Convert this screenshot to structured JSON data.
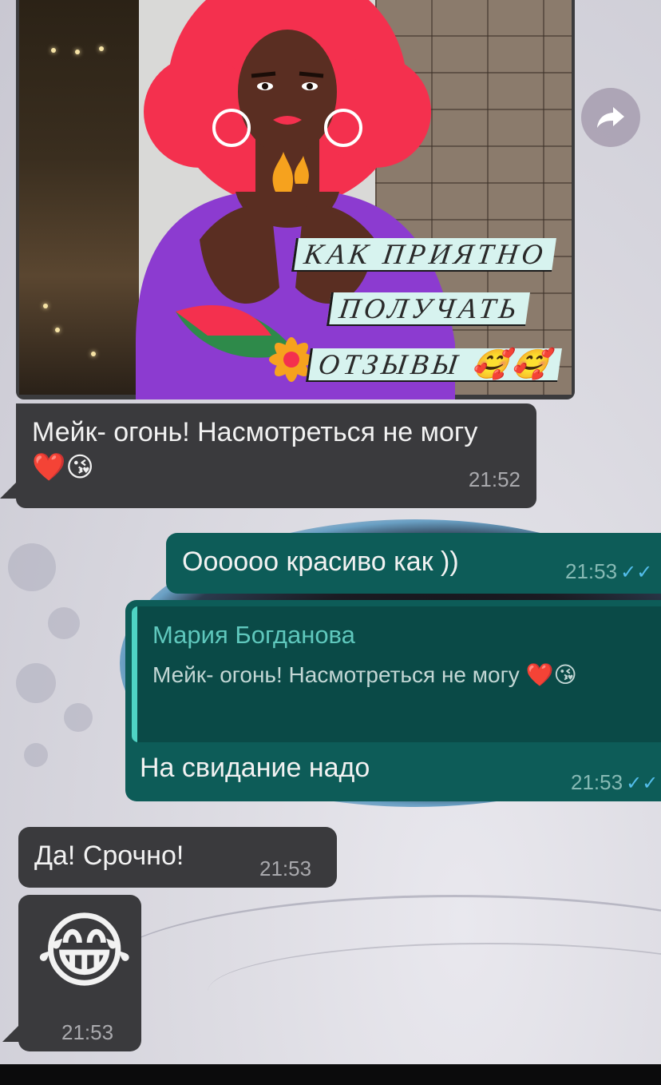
{
  "image_message": {
    "caption_lines": [
      "КАК ПРИЯТНО",
      "ПОЛУЧАТЬ",
      "ОТЗЫВЫ 🥰🥰"
    ]
  },
  "icons": {
    "forward": "forward-arrow-icon",
    "read": "double-check-icon"
  },
  "messages": [
    {
      "text": "Мейк- огонь! Насмотреться не могу ❤️😘",
      "time": "21:52"
    },
    {
      "text": "Оооооо красиво как ))",
      "time": "21:53",
      "ticks": "✓✓"
    },
    {
      "reply_to": {
        "name": "Мария Богданова",
        "text": "Мейк- огонь! Насмотреться не могу ❤️😘"
      },
      "text": "На свидание надо",
      "time": "21:53",
      "ticks": "✓✓"
    },
    {
      "text": "Да! Срочно!",
      "time": "21:53"
    },
    {
      "text": "😂",
      "time": "21:53"
    }
  ],
  "colors": {
    "incoming": "#3a3a3d",
    "outgoing": "#0d5c58",
    "read_ticks": "#53bdeb",
    "reply_name": "#5fc8bd"
  }
}
